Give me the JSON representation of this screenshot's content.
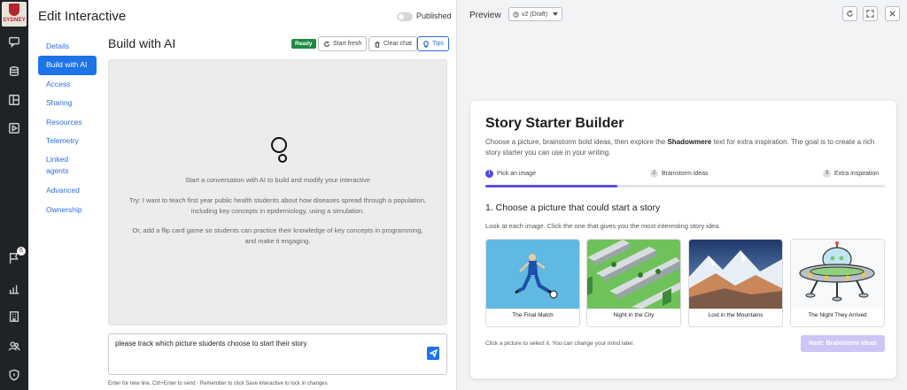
{
  "brand": {
    "logo_text": "SYDNEY"
  },
  "rail": {
    "icons": [
      "chat-icon",
      "database-icon",
      "layout-icon",
      "play-icon",
      "flag-icon",
      "bar-chart-icon",
      "building-icon",
      "users-icon",
      "shield-icon"
    ],
    "flag_badge": "6"
  },
  "header": {
    "title": "Edit Interactive",
    "published_label": "Published",
    "published": false
  },
  "subnav": {
    "items": [
      {
        "label": "Details",
        "active": false
      },
      {
        "label": "Build with AI",
        "active": true
      },
      {
        "label": "Access",
        "active": false
      },
      {
        "label": "Sharing",
        "active": false
      },
      {
        "label": "Resources",
        "active": false
      },
      {
        "label": "Telemetry",
        "active": false
      },
      {
        "label": "Linked agents",
        "active": false
      },
      {
        "label": "Advanced",
        "active": false
      },
      {
        "label": "Ownership",
        "active": false
      }
    ]
  },
  "build": {
    "title": "Build with AI",
    "status": "Ready",
    "start_fresh": "Start fresh",
    "clear_chat": "Clear chat",
    "tips": "Tips",
    "empty_title": "Start a conversation with AI to build and modify your interactive",
    "example1_line1": "Try: I want to teach first year public health students about how diseases spread through a population,",
    "example1_line2": "including key concepts in epidemiology, using a simulation.",
    "example2_line1": "Or, add a flip card game so students can practice their knowledge of key concepts in programming,",
    "example2_line2": "and make it engaging.",
    "input_value": "please track which picture students choose to start their story",
    "hint": "Enter for new line, Ctrl+Enter to send · Remember to click Save interactive to lock in changes"
  },
  "preview": {
    "label": "Preview",
    "version": "v2 (Draft)"
  },
  "story": {
    "title": "Story Starter Builder",
    "desc_before": "Choose a picture, brainstorm bold ideas, then explore the ",
    "desc_bold": "Shadowmere",
    "desc_after": " text for extra inspiration. The goal is to create a rich story starter you can use in your writing.",
    "steps": [
      {
        "num": "1",
        "label": "Pick an image"
      },
      {
        "num": "2",
        "label": "Brainstorm ideas"
      },
      {
        "num": "3",
        "label": "Extra inspiration"
      }
    ],
    "progress": 0.33,
    "question": "1. Choose a picture that could start a story",
    "instruction": "Look at each image. Click the one that gives you the most interesting story idea.",
    "pictures": [
      {
        "label": "The Final Match"
      },
      {
        "label": "Night in the City"
      },
      {
        "label": "Lost in the Mountains"
      },
      {
        "label": "The Night They Arrived"
      }
    ],
    "footer_hint": "Click a picture to select it. You can change your mind later.",
    "next_button": "Next: Brainstorm ideas"
  }
}
